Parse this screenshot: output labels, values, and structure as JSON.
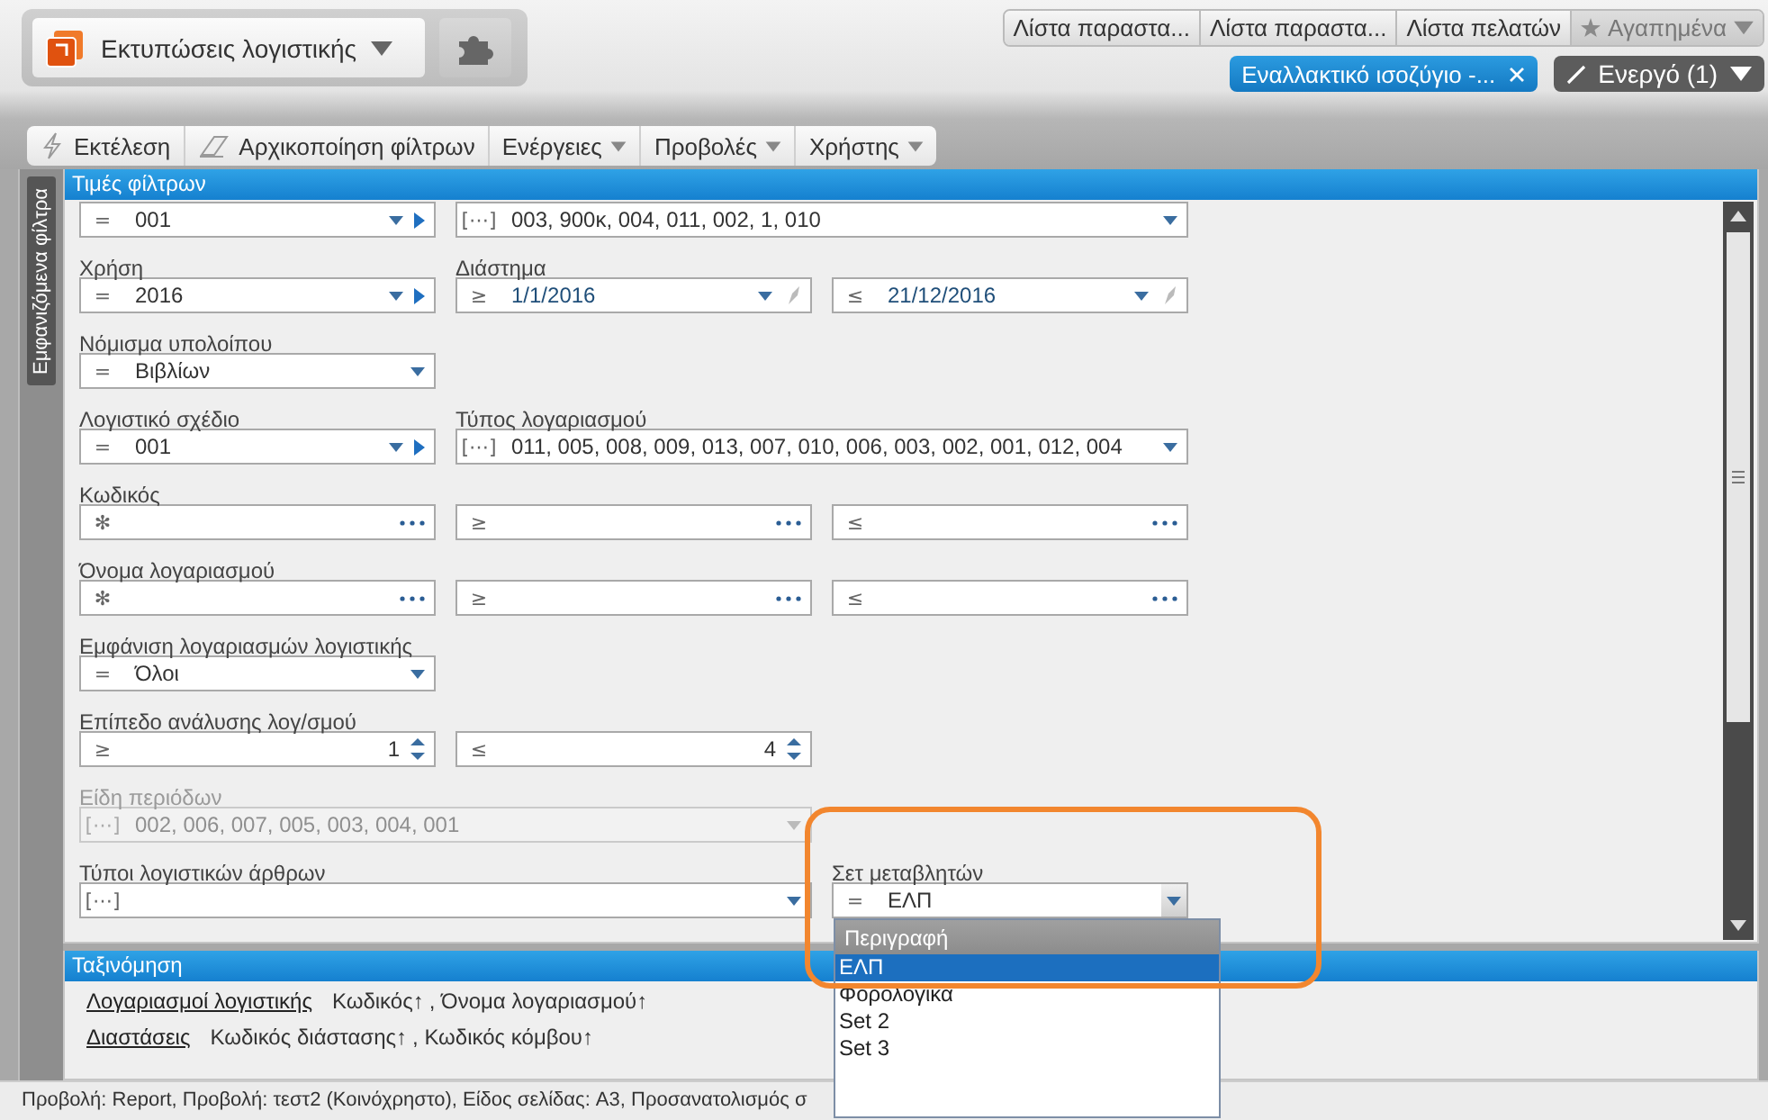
{
  "app_selector": {
    "label": "Εκτυπώσεις λογιστικής"
  },
  "open_tabs": [
    {
      "label": "Λίστα παραστα..."
    },
    {
      "label": "Λίστα παραστα..."
    },
    {
      "label": "Λίστα πελατών"
    }
  ],
  "favorites": {
    "label": "Αγαπημένα"
  },
  "active_document": {
    "label": "Εναλλακτικό ισοζύγιο -..."
  },
  "active_count": {
    "label": "Ενεργό (1)"
  },
  "toolbar": [
    {
      "kind": "run",
      "label": "Εκτέλεση"
    },
    {
      "kind": "reset",
      "label": "Αρχικοποίηση φίλτρων"
    },
    {
      "kind": "menu",
      "label": "Ενέργειες"
    },
    {
      "kind": "menu",
      "label": "Προβολές"
    },
    {
      "kind": "menu",
      "label": "Χρήστης"
    }
  ],
  "side_tab": {
    "label": "Εμφανιζόμενα φίλτρα"
  },
  "filters": {
    "title": "Τιμές φίλτρων",
    "rows": [
      {
        "fields": [
          {
            "operator": "=",
            "value": "001",
            "kind": "dropdown-nav",
            "disabled": false
          },
          {
            "operator": "[⋯]",
            "value": "003, 900κ, 004, 011, 002, 1, 010",
            "kind": "multi-dropdown",
            "disabled": false
          }
        ]
      },
      {
        "fields": [
          {
            "label": "Χρήση",
            "operator": "=",
            "value": "2016",
            "kind": "dropdown-nav",
            "disabled": false
          },
          {
            "label": "Διάστημα",
            "operator": "≥",
            "value": "1/1/2016",
            "kind": "date",
            "disabled": false
          },
          {
            "operator": "≤",
            "value": "21/12/2016",
            "kind": "date",
            "disabled": false
          }
        ]
      },
      {
        "fields": [
          {
            "label": "Νόμισμα υπολοίπου",
            "operator": "=",
            "value": "Βιβλίων",
            "kind": "dropdown",
            "disabled": false
          }
        ]
      },
      {
        "fields": [
          {
            "label": "Λογιστικό σχέδιο",
            "operator": "=",
            "value": "001",
            "kind": "dropdown-nav",
            "disabled": false
          },
          {
            "label": "Τύπος λογαριασμού",
            "operator": "[⋯]",
            "value": "011, 005, 008, 009, 013, 007, 010, 006, 003, 002, 001, 012, 004",
            "kind": "multi-dropdown",
            "disabled": false
          }
        ]
      },
      {
        "fields": [
          {
            "label": "Κωδικός",
            "operator": "✻",
            "kind": "lookup",
            "disabled": false
          },
          {
            "operator": "≥",
            "kind": "lookup",
            "disabled": false
          },
          {
            "operator": "≤",
            "kind": "lookup",
            "disabled": false
          }
        ]
      },
      {
        "fields": [
          {
            "label": "Όνομα λογαριασμού",
            "operator": "✻",
            "kind": "lookup",
            "disabled": false
          },
          {
            "operator": "≥",
            "kind": "lookup",
            "disabled": false
          },
          {
            "operator": "≤",
            "kind": "lookup",
            "disabled": false
          }
        ]
      },
      {
        "fields": [
          {
            "label": "Εμφάνιση λογαριασμών λογιστικής",
            "operator": "=",
            "value": "Όλοι",
            "kind": "dropdown",
            "disabled": false
          }
        ]
      },
      {
        "fields": [
          {
            "label": "Επίπεδο ανάλυσης λογ/σμού",
            "operator": "≥",
            "value": "1",
            "kind": "spinner",
            "disabled": false
          },
          {
            "operator": "≤",
            "value": "4",
            "kind": "spinner",
            "disabled": false
          }
        ]
      },
      {
        "fields": [
          {
            "label": "Είδη περιόδων",
            "operator": "[⋯]",
            "value": "002, 006, 007, 005, 003, 004, 001",
            "kind": "multi-dropdown",
            "disabled": true
          }
        ]
      },
      {
        "fields": [
          {
            "label": "Τύποι λογιστικών άρθρων",
            "operator": "[⋯]",
            "kind": "multi-dropdown",
            "disabled": false
          },
          {
            "label": "Σετ μεταβλητών",
            "operator": "=",
            "value": "ΕΛΠ",
            "kind": "open-dropdown",
            "disabled": false,
            "options": {
              "header": "Περιγραφή",
              "items": [
                {
                  "label": "ΕΛΠ",
                  "selected": true
                },
                {
                  "label": "Φορολογικά",
                  "selected": false
                },
                {
                  "label": "Set 2",
                  "selected": false
                },
                {
                  "label": "Set 3",
                  "selected": false
                }
              ]
            }
          }
        ]
      }
    ]
  },
  "sorting": {
    "title": "Ταξινόμηση",
    "groups": [
      {
        "name": "Λογαριασμοί λογιστικής",
        "keys": [
          "Κωδικός↑",
          ", Όνομα λογαριασμού↑"
        ]
      },
      {
        "name": "Διαστάσεις",
        "keys": [
          "Κωδικός διάστασης↑",
          ", Κωδικός κόμβου↑"
        ]
      }
    ]
  },
  "status_bar": {
    "text": "Προβολή: Report, Προβολή: τεστ2 (Κοινόχρηστο), Είδος σελίδας: A3, Προσανατολισμός σ"
  }
}
